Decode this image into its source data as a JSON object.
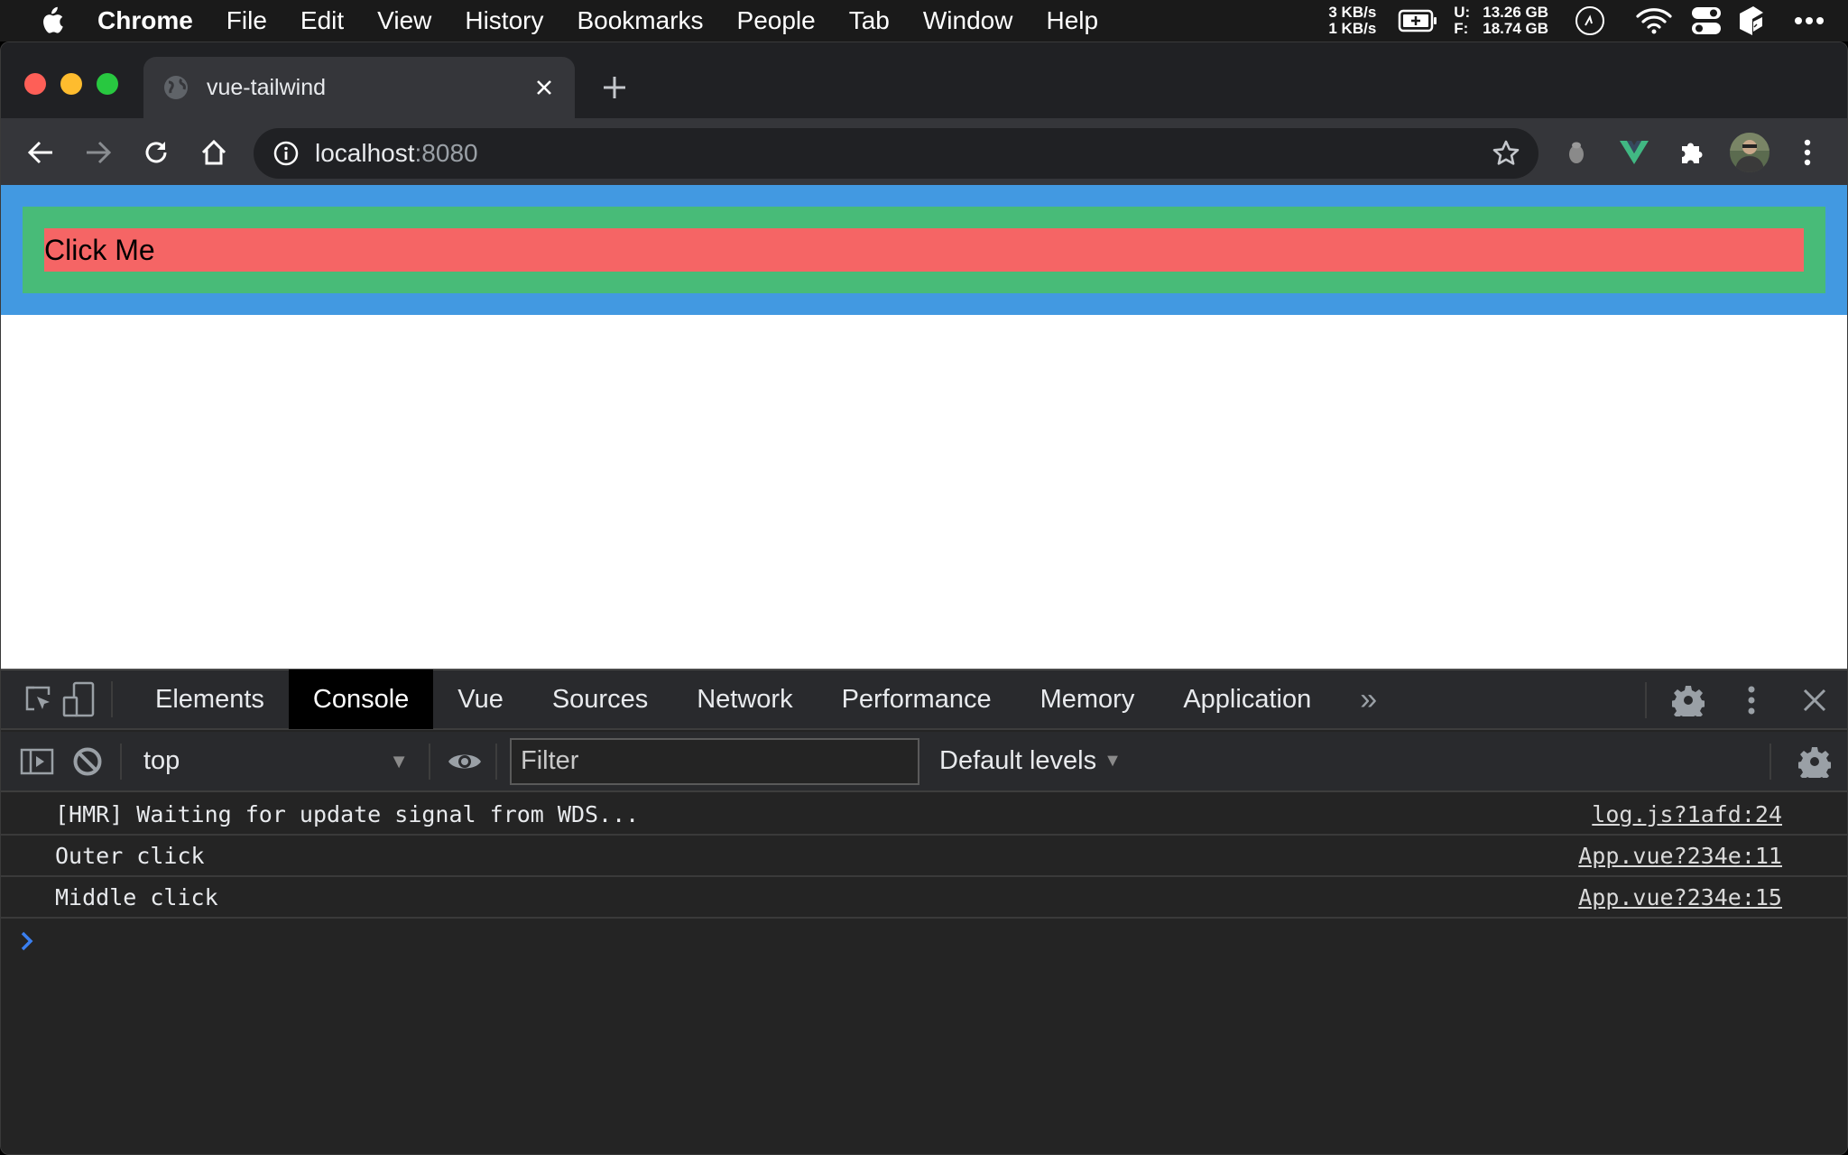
{
  "menubar": {
    "app_name": "Chrome",
    "items": [
      "File",
      "Edit",
      "View",
      "History",
      "Bookmarks",
      "People",
      "Tab",
      "Window",
      "Help"
    ],
    "net_up": "3 KB/s",
    "net_down": "1 KB/s",
    "mem_used_label": "U:",
    "mem_used": "13.26 GB",
    "mem_free_label": "F:",
    "mem_free": "18.74 GB"
  },
  "browser": {
    "tab_title": "vue-tailwind",
    "url_host": "localhost",
    "url_port": ":8080"
  },
  "page": {
    "button_label": "Click Me",
    "colors": {
      "outer": "#4299e1",
      "middle": "#48bb78",
      "inner": "#f56565"
    }
  },
  "devtools": {
    "tabs": [
      "Elements",
      "Console",
      "Vue",
      "Sources",
      "Network",
      "Performance",
      "Memory",
      "Application"
    ],
    "active_tab": "Console",
    "more_tabs": "»",
    "context": "top",
    "filter_placeholder": "Filter",
    "levels": "Default levels",
    "logs": [
      {
        "message": "[HMR] Waiting for update signal from WDS...",
        "source": "log.js?1afd:24"
      },
      {
        "message": "Outer click",
        "source": "App.vue?234e:11"
      },
      {
        "message": "Middle click",
        "source": "App.vue?234e:15"
      }
    ]
  }
}
